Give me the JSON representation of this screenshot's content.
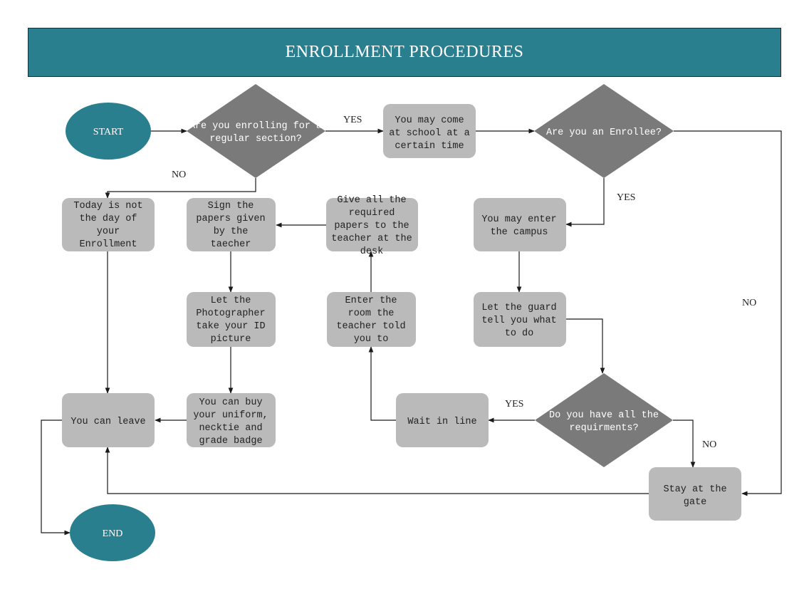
{
  "header": {
    "title": "ENROLLMENT  PROCEDURES"
  },
  "colors": {
    "banner": "#2a7f8f",
    "terminal": "#2a7f8f",
    "decision": "#7a7a7a",
    "process": "#bababa",
    "connector": "#1a1a1a"
  },
  "nodes": {
    "start": {
      "type": "terminal",
      "lines": [
        "START"
      ]
    },
    "q_regular": {
      "type": "decision",
      "lines": [
        "Are you enrolling for a",
        "regular section?"
      ]
    },
    "come_time": {
      "type": "process",
      "lines": [
        "You may come",
        "at school at a",
        "certain time"
      ]
    },
    "q_enrollee": {
      "type": "decision",
      "lines": [
        "Are you an Enrollee?"
      ]
    },
    "not_day": {
      "type": "process",
      "lines": [
        "Today is not",
        "the day of",
        "your",
        "Enrollment"
      ]
    },
    "sign_papers": {
      "type": "process",
      "lines": [
        "Sign the",
        "papers given",
        "by the",
        "taecher"
      ]
    },
    "give_papers": {
      "type": "process",
      "lines": [
        "Give all the",
        "required",
        "papers to the",
        "teacher at the",
        "desk"
      ]
    },
    "enter_campus": {
      "type": "process",
      "lines": [
        "You may enter",
        "the campus"
      ]
    },
    "photographer": {
      "type": "process",
      "lines": [
        "Let the",
        "Photographer",
        "take your ID",
        "picture"
      ]
    },
    "enter_room": {
      "type": "process",
      "lines": [
        "Enter the",
        "room the",
        "teacher told",
        "you to"
      ]
    },
    "guard": {
      "type": "process",
      "lines": [
        "Let the guard",
        "tell you what",
        "to do"
      ]
    },
    "leave": {
      "type": "process",
      "lines": [
        "You can leave"
      ]
    },
    "buy_uniform": {
      "type": "process",
      "lines": [
        "You can buy",
        "your uniform,",
        "necktie and",
        "grade badge"
      ]
    },
    "wait_line": {
      "type": "process",
      "lines": [
        "Wait in line"
      ]
    },
    "q_requirements": {
      "type": "decision",
      "lines": [
        "Do you have all the",
        "requirments?"
      ]
    },
    "stay_gate": {
      "type": "process",
      "lines": [
        "Stay at the",
        "gate"
      ]
    },
    "end": {
      "type": "terminal",
      "lines": [
        "END"
      ]
    }
  },
  "edge_labels": {
    "regular_yes": "YES",
    "regular_no": "NO",
    "enrollee_yes": "YES",
    "enrollee_no": "NO",
    "requirements_yes": "YES",
    "requirements_no": "NO"
  },
  "edges": [
    {
      "from": "start",
      "to": "q_regular"
    },
    {
      "from": "q_regular",
      "to": "come_time",
      "label": "YES"
    },
    {
      "from": "q_regular",
      "to": "not_day",
      "label": "NO"
    },
    {
      "from": "come_time",
      "to": "q_enrollee"
    },
    {
      "from": "q_enrollee",
      "to": "enter_campus",
      "label": "YES"
    },
    {
      "from": "q_enrollee",
      "to": "stay_gate",
      "label": "NO"
    },
    {
      "from": "enter_campus",
      "to": "guard"
    },
    {
      "from": "guard",
      "to": "q_requirements"
    },
    {
      "from": "q_requirements",
      "to": "wait_line",
      "label": "YES"
    },
    {
      "from": "q_requirements",
      "to": "stay_gate",
      "label": "NO"
    },
    {
      "from": "wait_line",
      "to": "enter_room"
    },
    {
      "from": "enter_room",
      "to": "give_papers"
    },
    {
      "from": "give_papers",
      "to": "sign_papers"
    },
    {
      "from": "sign_papers",
      "to": "photographer"
    },
    {
      "from": "photographer",
      "to": "buy_uniform"
    },
    {
      "from": "buy_uniform",
      "to": "leave"
    },
    {
      "from": "not_day",
      "to": "leave"
    },
    {
      "from": "stay_gate",
      "to": "leave"
    },
    {
      "from": "leave",
      "to": "end"
    }
  ]
}
